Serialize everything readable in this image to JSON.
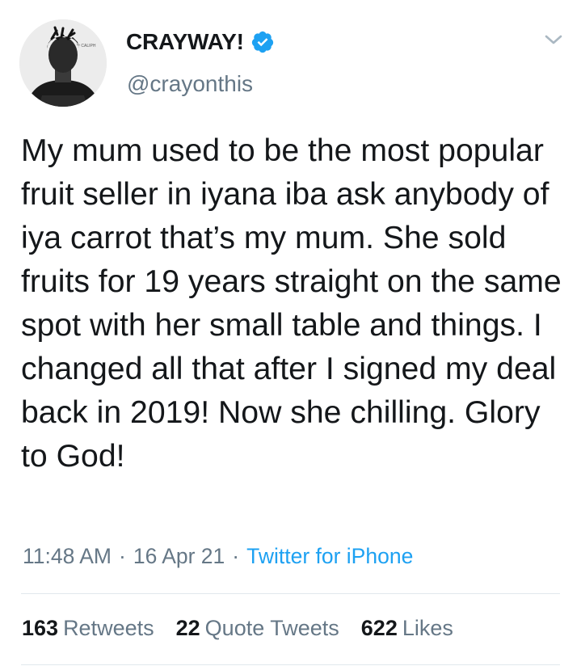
{
  "author": {
    "display_name": "CRAYWAY!",
    "handle": "@crayonthis",
    "verified": true,
    "shirt_text": "™ CALIPH"
  },
  "tweet": {
    "text": "My mum used to be the most popular fruit seller in iyana iba ask anybody of iya carrot that’s my mum. She sold fruits for 19 years straight on the same spot with her small table and things. I changed all that after I signed my deal back in 2019! Now she chilling. Glory to God!",
    "time": "11:48 AM",
    "date": "16 Apr 21",
    "separator": "·",
    "source": "Twitter for iPhone"
  },
  "stats": {
    "retweets_count": "163",
    "retweets_label": "Retweets",
    "quotes_count": "22",
    "quotes_label": "Quote Tweets",
    "likes_count": "622",
    "likes_label": "Likes"
  },
  "colors": {
    "text": "#14171a",
    "secondary": "#657786",
    "accent": "#1da1f2",
    "divider": "#e1e8ed"
  },
  "icons": {
    "verified": "verified-badge-icon",
    "menu": "chevron-down-icon"
  }
}
